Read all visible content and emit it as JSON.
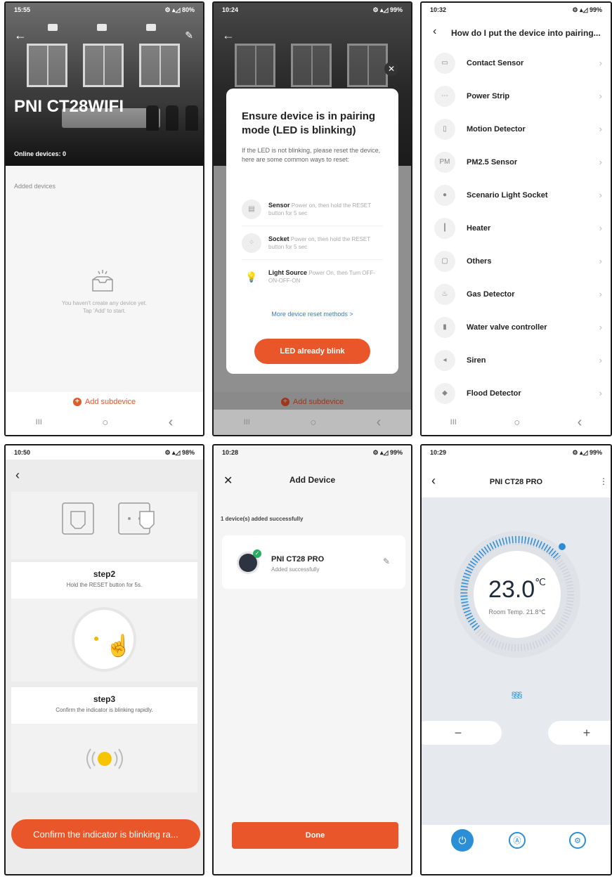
{
  "s1": {
    "time": "15:55",
    "status_icons": "⚙ ▴◿ 80%",
    "title": "PNI CT28WIFI",
    "online": "Online devices: 0",
    "section": "Added devices",
    "empty_line1": "You haven't create any device yet.",
    "empty_line2": "Tap 'Add' to start.",
    "add_label": "Add subdevice"
  },
  "s2": {
    "time": "10:24",
    "status_icons": "⚙ ▴◿ 99%",
    "dialog_title": "Ensure device is in pairing mode (LED is blinking)",
    "dialog_text": "If the LED is not blinking, please reset the device, here are some common ways to reset:",
    "rows": [
      {
        "name": "Sensor",
        "desc": "Power on, then hold the RESET button for 5 sec"
      },
      {
        "name": "Socket",
        "desc": "Power on, then hold the RESET button for 5 sec"
      },
      {
        "name": "Light Source",
        "desc": "Power On, then Turn OFF-ON-OFF-ON"
      }
    ],
    "more_link": "More device reset methods >",
    "confirm_button": "LED already blink",
    "add_label": "Add subdevice"
  },
  "s3": {
    "time": "10:32",
    "status_icons": "⚙ ▴◿ 99%",
    "title": "How do I put the device into pairing...",
    "items": [
      {
        "label": "Contact Sensor",
        "icon": "contact-sensor-icon"
      },
      {
        "label": "Power Strip",
        "icon": "power-strip-icon"
      },
      {
        "label": "Motion Detector",
        "icon": "motion-detector-icon"
      },
      {
        "label": "PM2.5 Sensor",
        "icon": "pm25-sensor-icon"
      },
      {
        "label": "Scenario Light Socket",
        "icon": "light-socket-icon"
      },
      {
        "label": "Heater",
        "icon": "heater-icon"
      },
      {
        "label": "Others",
        "icon": "others-icon"
      },
      {
        "label": "Gas Detector",
        "icon": "gas-detector-icon"
      },
      {
        "label": "Water valve controller",
        "icon": "water-valve-icon"
      },
      {
        "label": "Siren",
        "icon": "siren-icon"
      },
      {
        "label": "Flood Detector",
        "icon": "flood-detector-icon"
      }
    ]
  },
  "s4": {
    "time": "10:50",
    "status_icons": "⚙ ▴◿ 98%",
    "step2_title": "step2",
    "step2_text": "Hold the RESET button for 5s.",
    "step3_title": "step3",
    "step3_text": "Confirm the indicator is blinking rapidly.",
    "button": "Confirm the indicator is blinking ra..."
  },
  "s5": {
    "time": "10:28",
    "status_icons": "⚙ ▴◿ 99%",
    "title": "Add Device",
    "count_text": "1 device(s) added successfully",
    "device_name": "PNI CT28 PRO",
    "device_status": "Added successfully",
    "done": "Done"
  },
  "s6": {
    "time": "10:29",
    "status_icons": "⚙ ▴◿ 99%",
    "title": "PNI CT28 PRO",
    "temp": "23.0",
    "unit": "℃",
    "room": "Room Temp. 21.8℃",
    "heat_glyph": "§§§",
    "minus": "−",
    "plus": "+"
  },
  "nav": {
    "recent": "III",
    "home": "○",
    "back": "‹"
  },
  "colors": {
    "accent": "#e8562a",
    "blue": "#2a8fd6",
    "green": "#27ae60"
  }
}
